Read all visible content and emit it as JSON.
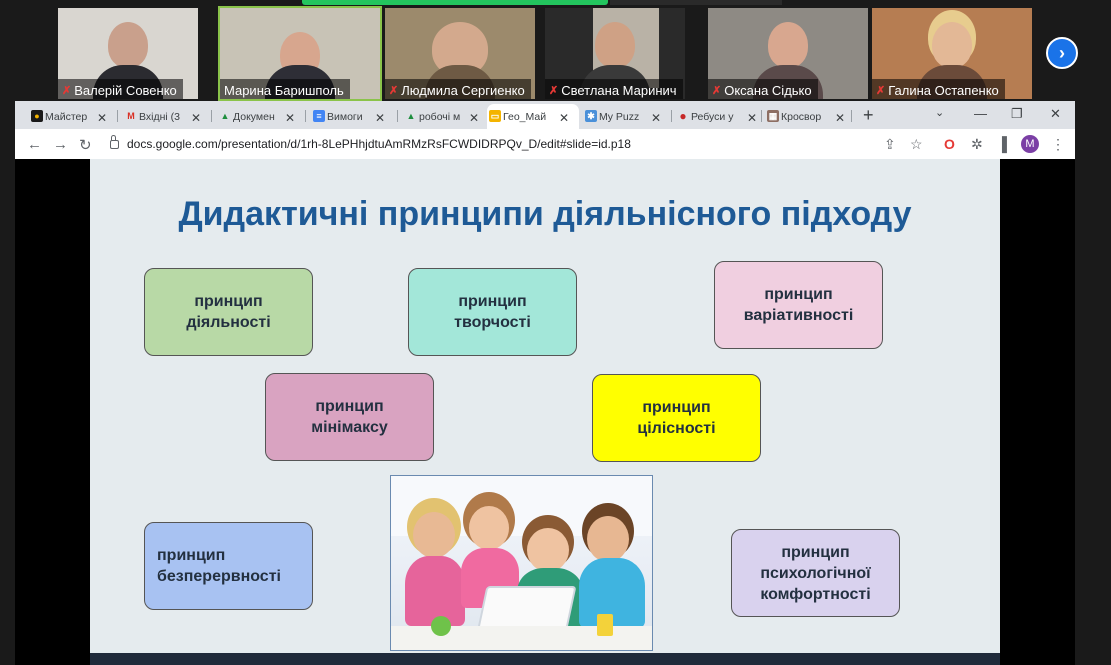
{
  "meeting": {
    "participants": [
      {
        "name": "Валерій Совенко",
        "muted": true
      },
      {
        "name": "Марина Баришполь",
        "muted": false
      },
      {
        "name": "Людмила Сергиенко",
        "muted": true
      },
      {
        "name": "Светлана Маринич",
        "muted": true
      },
      {
        "name": "Оксана Сідько",
        "muted": true
      },
      {
        "name": "Галина Остапенко",
        "muted": true
      }
    ],
    "next_icon": "chevron-right-icon"
  },
  "browser": {
    "tabs": [
      {
        "label": "Майстер",
        "icon": "mystery-icon",
        "color": "#d32f2f"
      },
      {
        "label": "Вхідні (3",
        "icon": "gmail-icon",
        "color": "#d93025"
      },
      {
        "label": "Докумен",
        "icon": "drive-icon",
        "color": "#1e8e3e"
      },
      {
        "label": "Вимоги",
        "icon": "docs-icon",
        "color": "#4285f4"
      },
      {
        "label": "робочі м",
        "icon": "drive-icon",
        "color": "#1e8e3e"
      },
      {
        "label": "Гео_Май",
        "icon": "slides-icon",
        "color": "#f4b400",
        "active": true
      },
      {
        "label": "My Puzz",
        "icon": "puzzle-icon",
        "color": "#4a90d9"
      },
      {
        "label": "Ребуси у",
        "icon": "opera-icon",
        "color": "#c62828"
      },
      {
        "label": "Кросвор",
        "icon": "crossword-icon",
        "color": "#8d6e63"
      }
    ],
    "url": "docs.google.com/presentation/d/1rh-8LePHhjdtuAmRMzRsFCWDIDRPQv_D/edit#slide=id.p18",
    "profile_initial": "M"
  },
  "slide": {
    "title": "Дидактичні принципи діяльнісного підходу",
    "boxes": [
      {
        "line1": "принцип",
        "line2": "діяльності",
        "color": "#b8d9a6"
      },
      {
        "line1": "принцип",
        "line2": "творчості",
        "color": "#a3e7d9"
      },
      {
        "line1": "принцип",
        "line2": "варіативності",
        "color": "#f0cfe0"
      },
      {
        "line1": "принцип",
        "line2": "мінімаксу",
        "color": "#d9a3c1"
      },
      {
        "line1": "принцип",
        "line2": "цілісності",
        "color": "#ffff00"
      },
      {
        "line1": "принцип",
        "line2": "безперервності",
        "color": "#a8c2f2"
      },
      {
        "line1": "принцип",
        "line2": "психологічної",
        "line3": "комфортності",
        "color": "#d9d2ee"
      }
    ]
  }
}
